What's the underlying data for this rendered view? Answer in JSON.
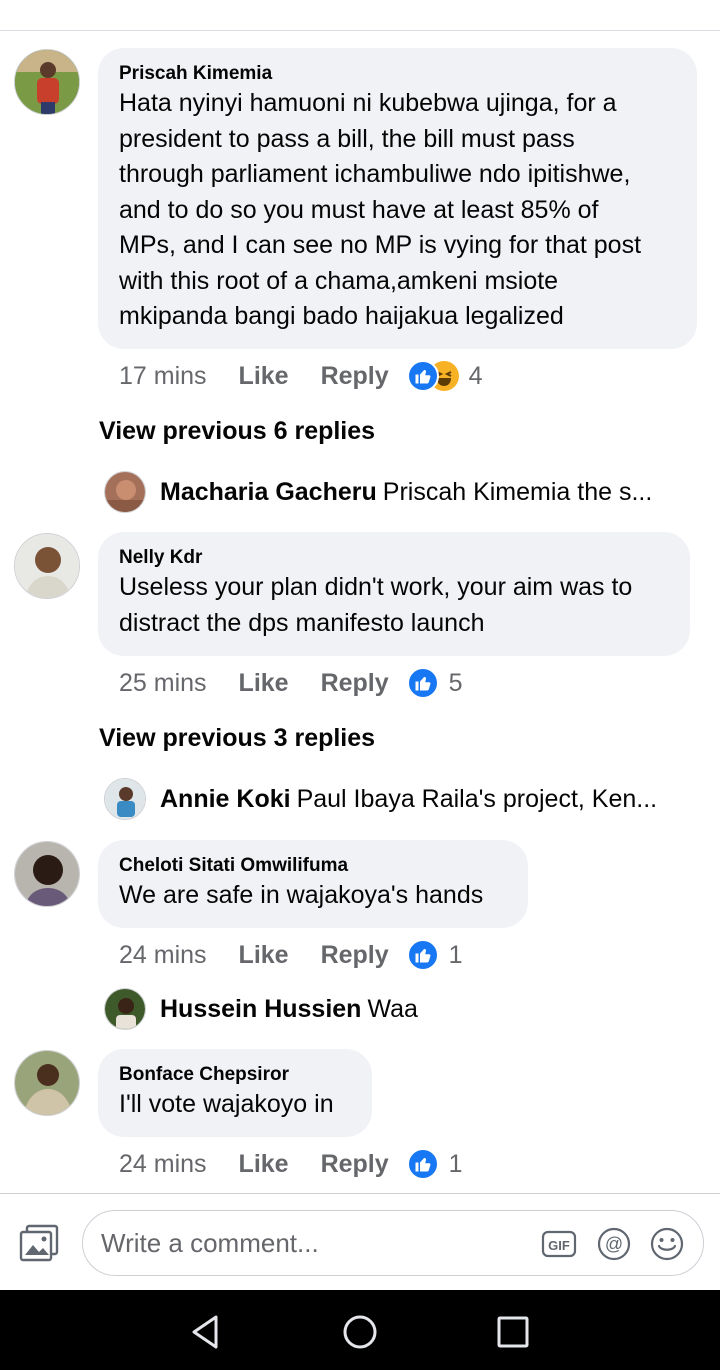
{
  "comments": [
    {
      "author": "Priscah Kimemia",
      "lines": [
        "Hata nyinyi hamuoni ni kubebwa ujinga, for a",
        "president to pass a bill, the bill must pass",
        "through parliament ichambuliwe ndo ipitishwe,",
        "and to do so you must have at least 85% of",
        "MPs, and I can see no MP is vying for that post",
        "with this root of a chama,amkeni msiote",
        "mkipanda bangi bado haijakua legalized"
      ],
      "time": "17 mins",
      "like_label": "Like",
      "reply_label": "Reply",
      "reaction_count": "4",
      "view_replies": "View previous 6 replies",
      "reply": {
        "name": "Macharia Gacheru",
        "text": "Priscah Kimemia the s..."
      }
    },
    {
      "author": "Nelly Kdr",
      "lines": [
        "Useless your plan didn't work, your aim was to",
        "distract the dps manifesto launch"
      ],
      "time": "25 mins",
      "like_label": "Like",
      "reply_label": "Reply",
      "reaction_count": "5",
      "view_replies": "View previous 3 replies",
      "reply": {
        "name": "Annie Koki",
        "text": "Paul Ibaya Raila's project, Ken..."
      }
    },
    {
      "author": "Cheloti Sitati Omwilifuma",
      "lines": [
        "We are safe in wajakoya's hands"
      ],
      "time": "24 mins",
      "like_label": "Like",
      "reply_label": "Reply",
      "reaction_count": "1",
      "reply": {
        "name": "Hussein Hussien",
        "text": "Waa"
      }
    },
    {
      "author": "Bonface Chepsiror",
      "lines": [
        "I'll vote wajakoyo in"
      ],
      "time": "24 mins",
      "like_label": "Like",
      "reply_label": "Reply",
      "reaction_count": "1"
    }
  ],
  "composer": {
    "placeholder": "Write a comment...",
    "icons": [
      "photo-icon",
      "gif-icon",
      "mention-icon",
      "emoji-icon"
    ]
  },
  "navbar": {
    "icons": [
      "back-icon",
      "home-icon",
      "recents-icon"
    ]
  },
  "colors": {
    "accent": "#1877f2",
    "bubble": "#f0f2f5",
    "meta": "#65676b",
    "haha": "#f7b125"
  }
}
